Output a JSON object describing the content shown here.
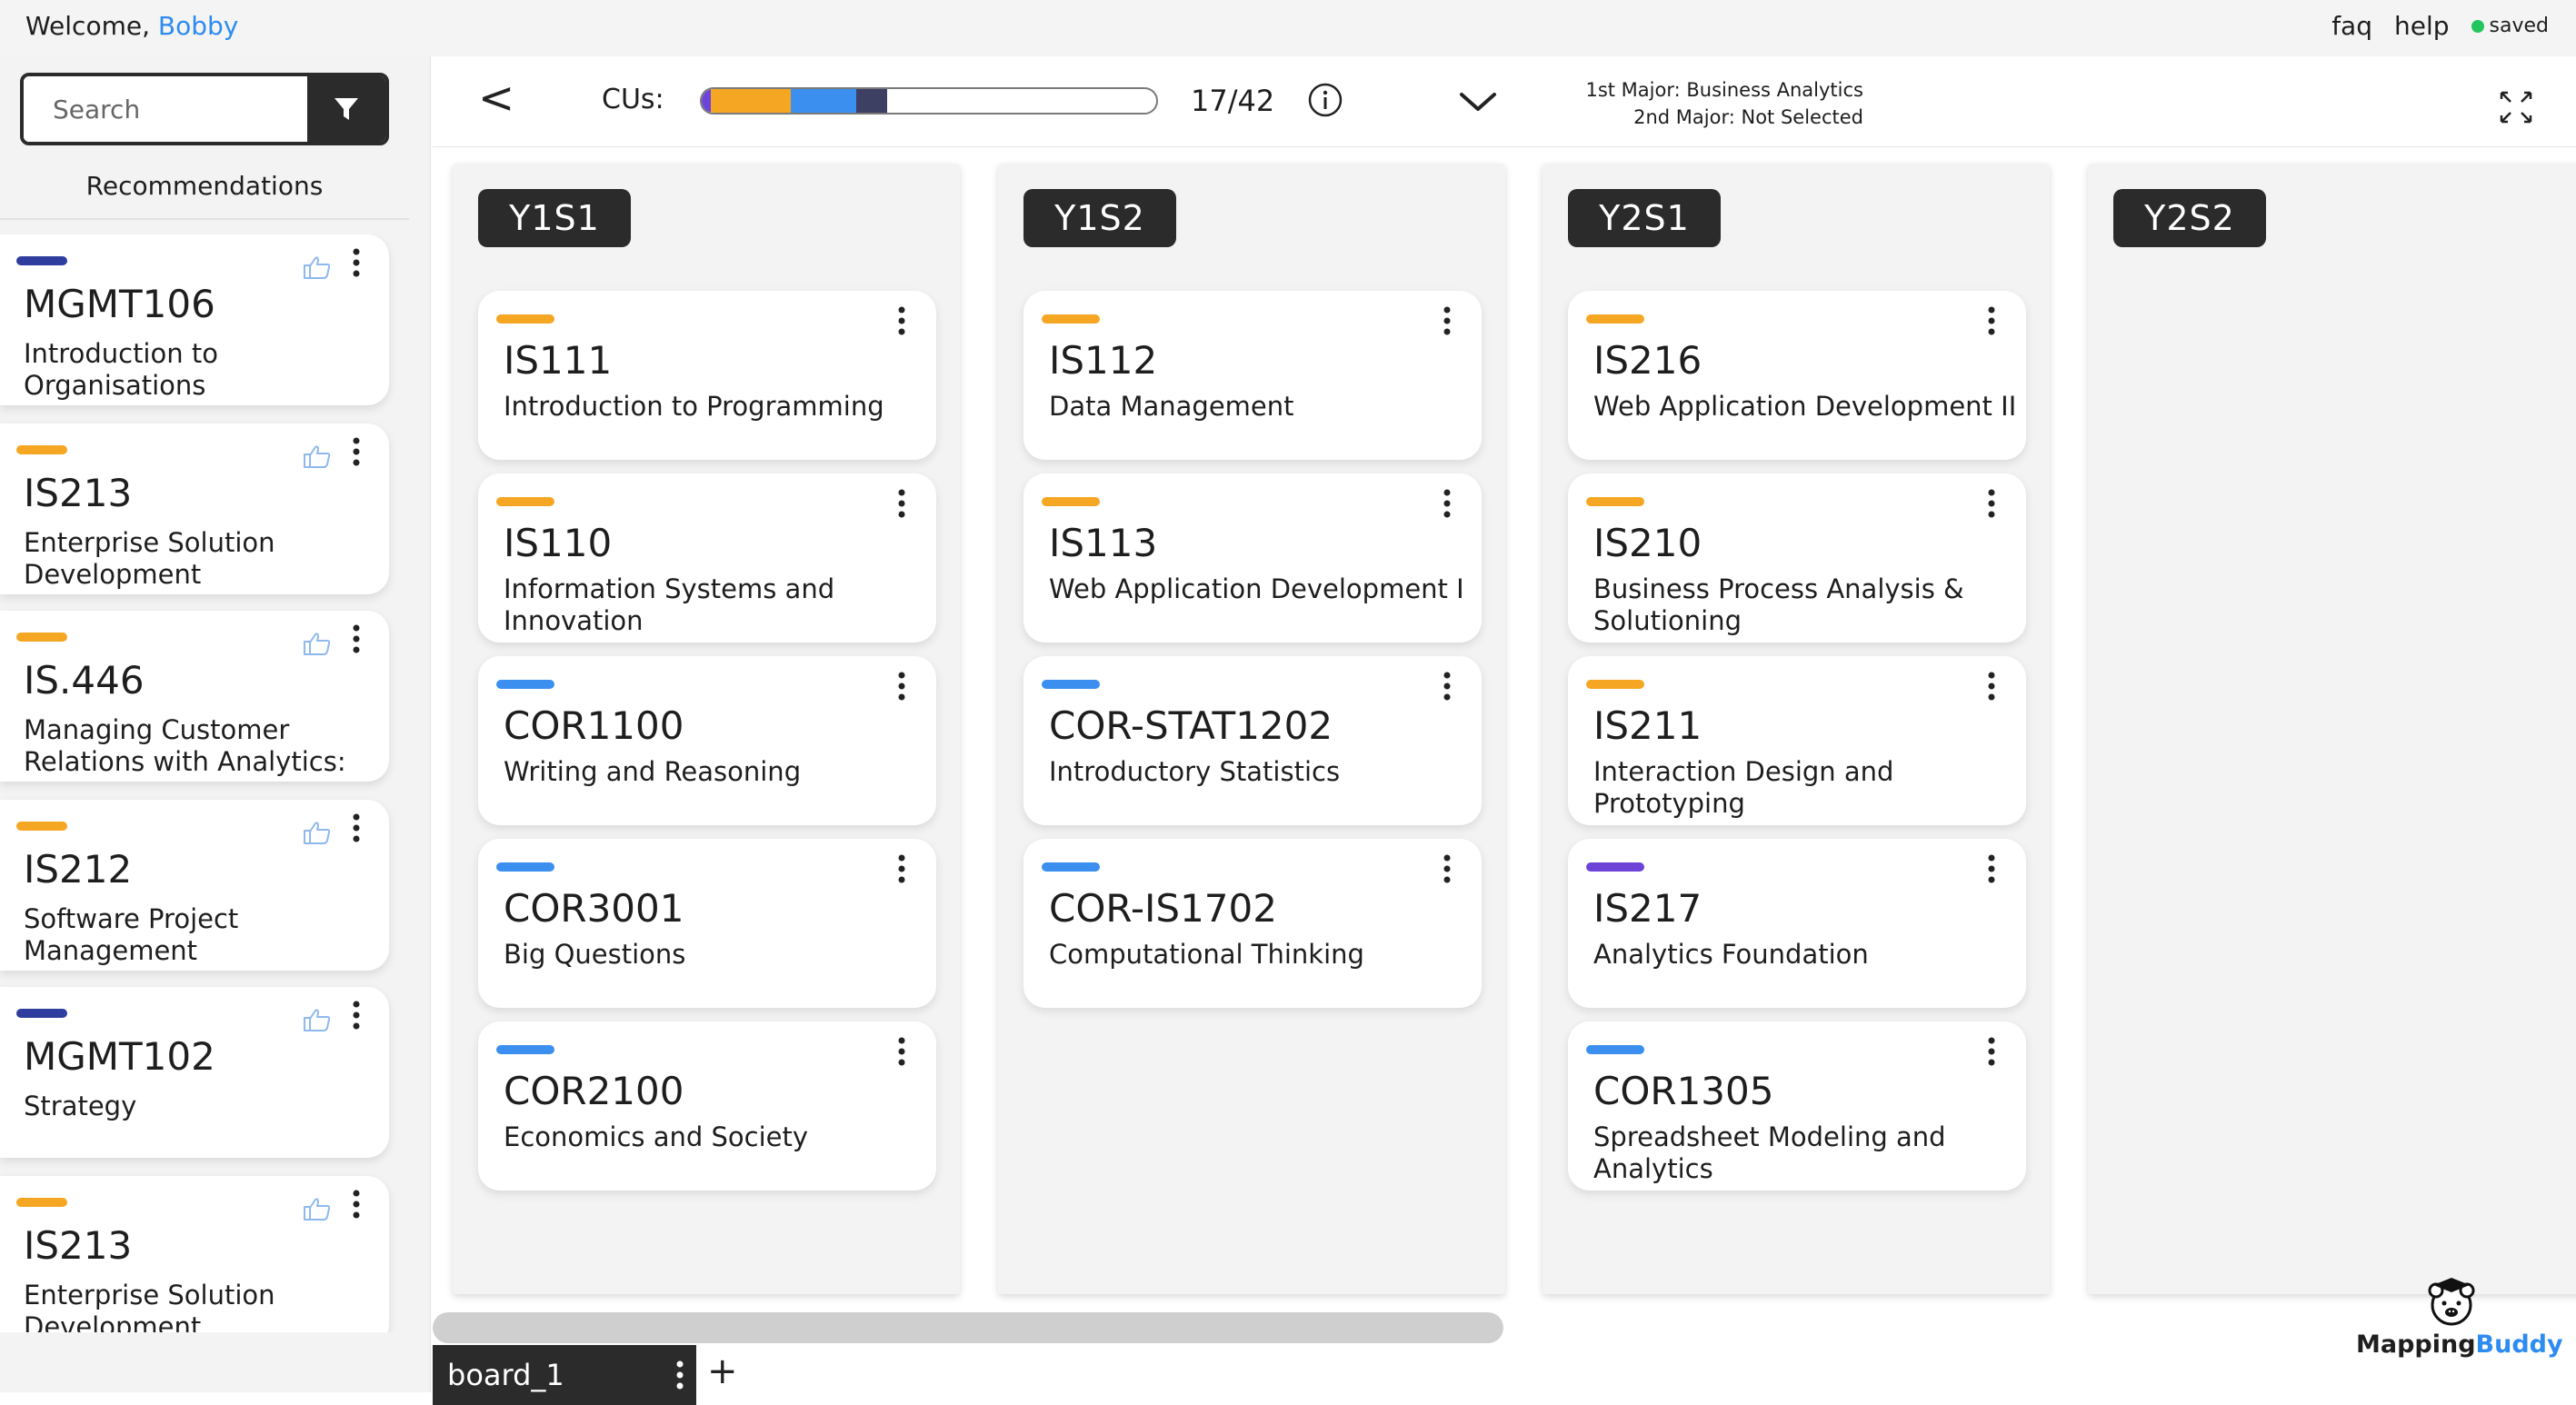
{
  "header": {
    "welcome_prefix": "Welcome,",
    "user_name": "Bobby",
    "faq": "faq",
    "help": "help",
    "saved": "saved"
  },
  "sidebar": {
    "search_placeholder": "Search",
    "recommendations_title": "Recommendations",
    "items": [
      {
        "code": "MGMT106",
        "name": "Introduction to Organisations",
        "bar_color": "#2f3e9e"
      },
      {
        "code": "IS213",
        "name": "Enterprise Solution Development",
        "bar_color": "#f5a623"
      },
      {
        "code": "IS.446",
        "name": "Managing Customer Relations with Analytics: Salesforce",
        "bar_color": "#f5a623"
      },
      {
        "code": "IS212",
        "name": "Software Project Management",
        "bar_color": "#f5a623"
      },
      {
        "code": "MGMT102",
        "name": "Strategy",
        "bar_color": "#2f3e9e"
      },
      {
        "code": "IS213",
        "name": "Enterprise Solution Development",
        "bar_color": "#f5a623"
      }
    ]
  },
  "toolbar": {
    "back": "<",
    "cus_label": "CUs:",
    "cu_count": "17/42",
    "progress_fraction": 0.4048,
    "major1": "1st Major: Business Analytics",
    "major2": "2nd Major: Not Selected"
  },
  "board": {
    "columns": [
      {
        "title": "Y1S1",
        "cards": [
          {
            "code": "IS111",
            "name": "Introduction to Programming",
            "bar_color": "#f5a623"
          },
          {
            "code": "IS110",
            "name": "Information Systems and Innovation",
            "bar_color": "#f5a623"
          },
          {
            "code": "COR1100",
            "name": "Writing and Reasoning",
            "bar_color": "#3b8fef"
          },
          {
            "code": "COR3001",
            "name": "Big Questions",
            "bar_color": "#3b8fef"
          },
          {
            "code": "COR2100",
            "name": "Economics and Society",
            "bar_color": "#3b8fef"
          }
        ]
      },
      {
        "title": "Y1S2",
        "cards": [
          {
            "code": "IS112",
            "name": "Data Management",
            "bar_color": "#f5a623"
          },
          {
            "code": "IS113",
            "name": "Web Application Development I",
            "bar_color": "#f5a623"
          },
          {
            "code": "COR-STAT1202",
            "name": "Introductory Statistics",
            "bar_color": "#3b8fef"
          },
          {
            "code": "COR-IS1702",
            "name": "Computational Thinking",
            "bar_color": "#3b8fef"
          }
        ]
      },
      {
        "title": "Y2S1",
        "cards": [
          {
            "code": "IS216",
            "name": "Web Application Development II",
            "bar_color": "#f5a623"
          },
          {
            "code": "IS210",
            "name": "Business Process Analysis & Solutioning",
            "bar_color": "#f5a623"
          },
          {
            "code": "IS211",
            "name": "Interaction Design and Prototyping",
            "bar_color": "#f5a623"
          },
          {
            "code": "IS217",
            "name": "Analytics Foundation",
            "bar_color": "#6e44d8"
          },
          {
            "code": "COR1305",
            "name": "Spreadsheet Modeling and Analytics",
            "bar_color": "#3b8fef"
          }
        ]
      },
      {
        "title": "Y2S2",
        "cards": []
      }
    ]
  },
  "footer": {
    "board_name": "board_1",
    "add_board": "+",
    "logo_part1": "Mapping",
    "logo_part2": "Buddy"
  },
  "colors": {
    "accent": "#2d8cf0",
    "dark": "#2b2b2b",
    "saved_dot": "#22c55e"
  }
}
